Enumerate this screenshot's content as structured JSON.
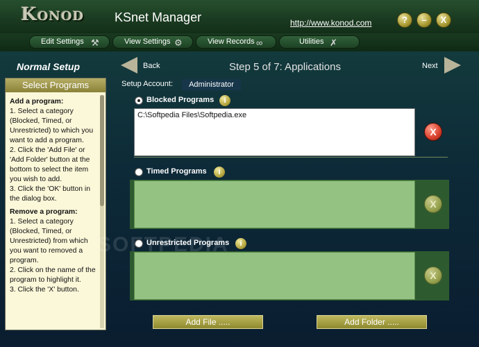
{
  "header": {
    "logo": "Konod",
    "title": "KSnet Manager",
    "url": "http://www.konod.com",
    "help_label": "?",
    "minimize_label": "–",
    "close_label": "X"
  },
  "menu": [
    {
      "label": "Edit Settings",
      "icon": "⚒"
    },
    {
      "label": "View Settings",
      "icon": "⚙"
    },
    {
      "label": "View Records",
      "icon": "∞"
    },
    {
      "label": "Utilities",
      "icon": "✗"
    }
  ],
  "sidebar": {
    "mode": "Normal Setup",
    "header": "Select Programs",
    "add_title": "Add a program:",
    "add_steps": [
      "1. Select a category (Blocked, Timed, or Unrestricted) to which you want to add a program.",
      "2. Click the 'Add File' or 'Add Folder' button at the bottom to select the item you wish to add.",
      "3. Click the 'OK' button in the dialog box."
    ],
    "remove_title": "Remove a program:",
    "remove_steps": [
      "1. Select a category (Blocked, Timed, or Unrestricted) from which you want to removed a program.",
      "2. Click on the name of the program to highlight it.",
      "3. Click the 'X' button."
    ]
  },
  "nav": {
    "back": "Back",
    "step": "Step 5 of 7:  Applications",
    "next": "Next"
  },
  "account": {
    "label": "Setup Account:",
    "value": "Administrator"
  },
  "sections": {
    "blocked": {
      "label": "Blocked Programs",
      "items": [
        "C:\\Softpedia Files\\Softpedia.exe"
      ]
    },
    "timed": {
      "label": "Timed Programs",
      "items": []
    },
    "unrestricted": {
      "label": "Unrestricted Programs",
      "items": []
    }
  },
  "buttons": {
    "add_file": "Add  File .....",
    "add_folder": "Add  Folder ....."
  },
  "watermark": "SOFTPEDIA",
  "colors": {
    "accent_green": "#93c283",
    "title_bar": "#1a3a20",
    "button_olive": "#a79f44"
  }
}
